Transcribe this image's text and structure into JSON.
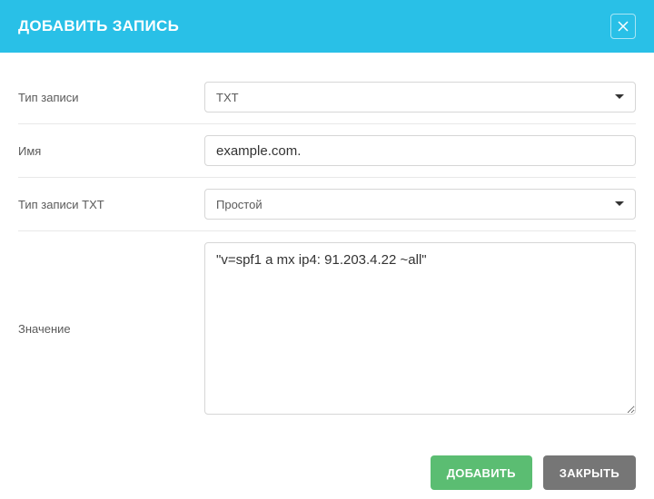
{
  "header": {
    "title": "ДОБАВИТЬ ЗАПИСЬ"
  },
  "form": {
    "record_type": {
      "label": "Тип записи",
      "value": "TXT"
    },
    "name": {
      "label": "Имя",
      "value": "example.com."
    },
    "txt_type": {
      "label": "Тип записи TXT",
      "value": "Простой"
    },
    "value": {
      "label": "Значение",
      "text": "\"v=spf1 a mx ip4: 91.203.4.22 ~all\""
    }
  },
  "footer": {
    "submit": "ДОБАВИТЬ",
    "close": "ЗАКРЫТЬ"
  }
}
